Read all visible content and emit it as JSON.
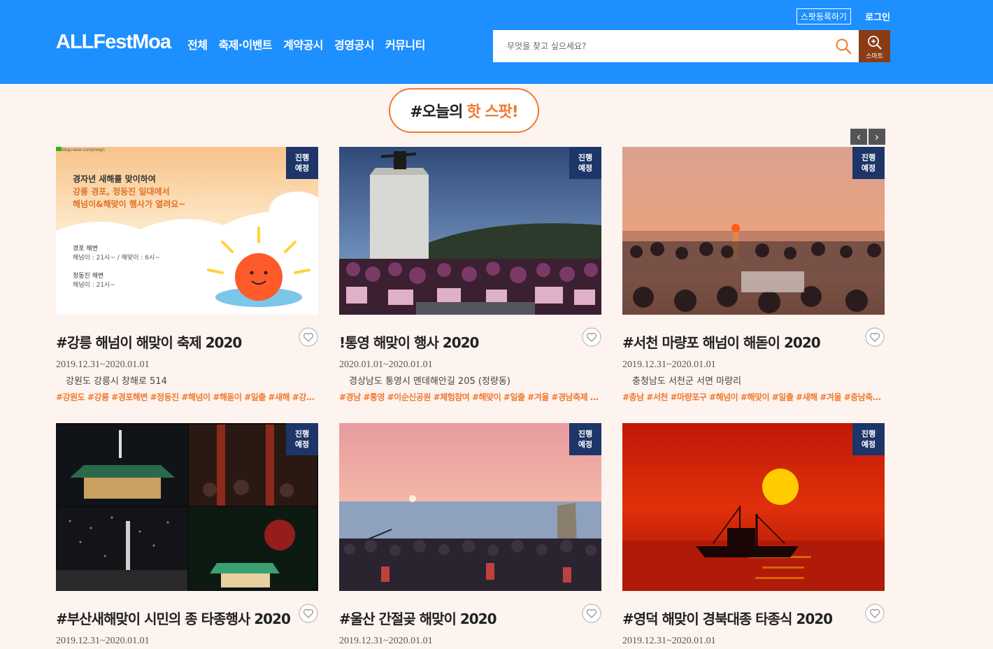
{
  "header": {
    "logo": "ALLFestMoa",
    "nav": [
      "전체",
      "축제·이벤트",
      "계약공시",
      "경영공시",
      "커뮤니티"
    ],
    "spot_register": "스팟등록하기",
    "login": "로그인",
    "search_placeholder": "무엇을 찾고 싶으세요?",
    "smart_label": "스마트"
  },
  "section": {
    "title_prefix": "#오늘의",
    "title_accent": "핫 스팟!",
    "prev_glyph": "‹",
    "next_glyph": "›"
  },
  "cards": [
    {
      "status": [
        "진행",
        "예정"
      ],
      "title": "#강릉 해넘이 해맞이 축제 2020",
      "date": "2019.12.31~2020.01.01",
      "address": "강원도 강릉시 창해로 514",
      "tags": "#강원도 #강릉 #경포해변 #정동진 #해넘이 #해돋이 #일출 #새해 #강원...",
      "poster": {
        "source": "blog.naver.com/pmegn",
        "line1": "경자년 새해를 맞이하여",
        "line2": "강릉 경포, 정동진 일대에서",
        "line3": "해넘이&해맞이 행사가 열려요~",
        "place1": "경포 해변",
        "time1": "해넘이 : 21시~ / 해맞이 : 6시~",
        "place2": "정동진 해변",
        "time2": "해넘이 : 21시~"
      }
    },
    {
      "status": [
        "진행",
        "예정"
      ],
      "title": "!통영 해맞이 행사 2020",
      "date": "2020.01.01~2020.01.01",
      "address": "경상남도 통영시 멘데해안길 205 (정량동)",
      "tags": "#경남 #통영 #이순신공원 #체험참여 #해맞이 #일출 #겨울 #경남축제 #..."
    },
    {
      "status": [
        "진행",
        "예정"
      ],
      "title": "#서천 마량포 해넘이 해돋이 2020",
      "date": "2019.12.31~2020.01.01",
      "address": "충청남도 서천군 서면 마량리",
      "tags": "#충남 #서천 #마량포구 #해넘이 #해맞이 #일출 #새해 #겨울 #충남축제 ..."
    },
    {
      "status": [
        "진행",
        "예정"
      ],
      "title": "#부산새해맞이 시민의 종 타종행사 2020",
      "date": "2019.12.31~2020.01.01",
      "address": "",
      "tags": ""
    },
    {
      "status": [
        "진행",
        "예정"
      ],
      "title": "#울산 간절곶 해맞이 2020",
      "date": "2019.12.31~2020.01.01",
      "address": "",
      "tags": ""
    },
    {
      "status": [
        "진행",
        "예정"
      ],
      "title": "#영덕 해맞이 경북대종 타종식 2020",
      "date": "2019.12.31~2020.01.01",
      "address": "",
      "tags": ""
    }
  ]
}
